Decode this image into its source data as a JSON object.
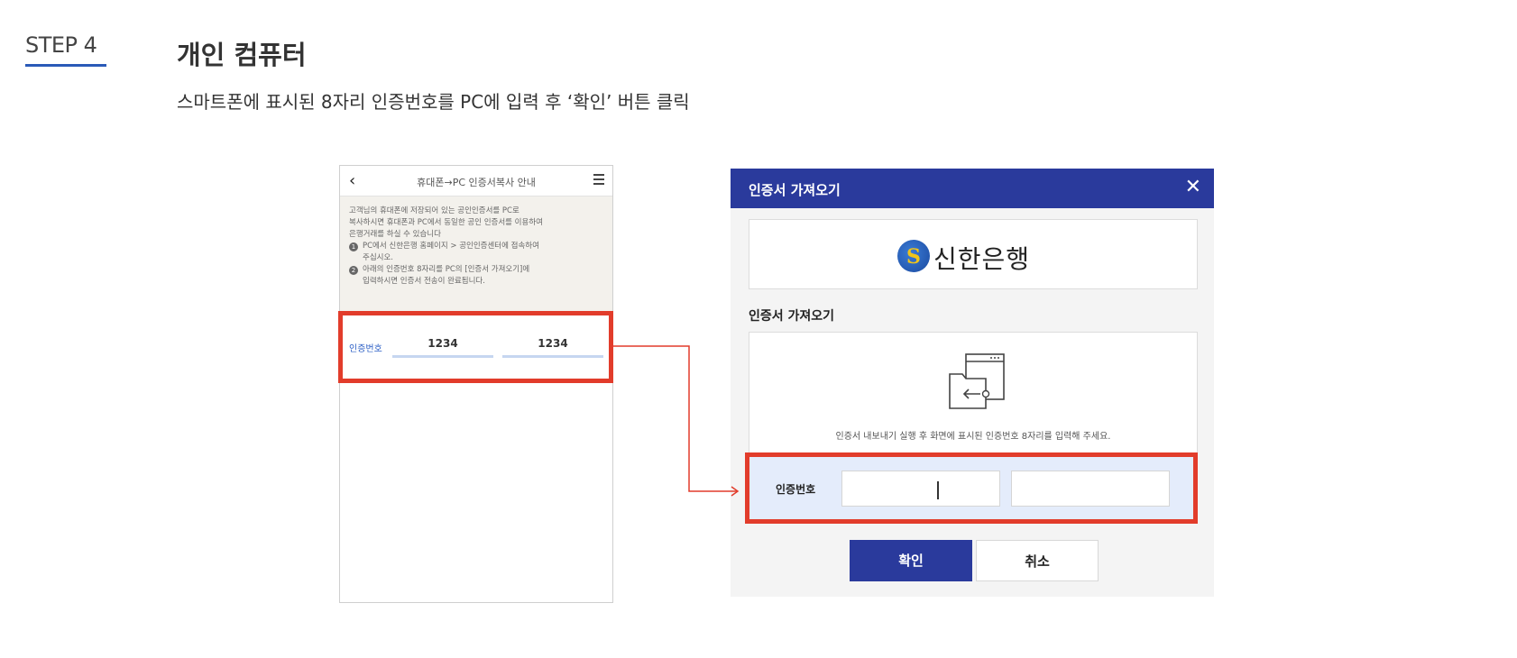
{
  "step": {
    "label": "STEP 4",
    "title": "개인 컴퓨터",
    "description": "스마트폰에 표시된 8자리 인증번호를 PC에 입력 후 ‘확인’ 버튼 클릭"
  },
  "phone": {
    "back_icon": "chevron-left-icon",
    "title": "휴대폰→PC 인증서복사 안내",
    "menu_icon": "hamburger-menu-icon",
    "intro": [
      "고객님의 휴대폰에 저장되어 있는 공인인증서를 PC로",
      "복사하시면 휴대폰과 PC에서 동일한 공인 인증서를 이용하여",
      "은행거래를 하실 수 있습니다"
    ],
    "steps": [
      {
        "num": "1",
        "lines": [
          "PC에서 신한은행 홈페이지 > 공인인증센터에 접속하여",
          "주십시오."
        ]
      },
      {
        "num": "2",
        "lines": [
          "아래의 인증번호 8자리를 PC의 [인증서 가져오기]에",
          "입력하시면 인증서 전송이 완료됩니다."
        ]
      }
    ],
    "code_label": "인증번호",
    "code_part1": "1234",
    "code_part2": "1234"
  },
  "dialog": {
    "title": "인증서 가져오기",
    "close_icon": "close-icon",
    "bank_logo_icon": "shinhan-logo-icon",
    "bank_name": "신한은행",
    "section_label": "인증서 가져오기",
    "folder_icon": "certificate-folder-icon",
    "instruction": "인증서 내보내기 실행 후 화면에 표시된 인증번호 8자리를 입력해 주세요.",
    "input_label": "인증번호",
    "input1_value": "",
    "input2_value": "",
    "confirm_label": "확인",
    "cancel_label": "취소"
  },
  "colors": {
    "accent_blue": "#2a3a9c",
    "highlight_red": "#e23c2b",
    "step_underline": "#2a5ab8"
  }
}
